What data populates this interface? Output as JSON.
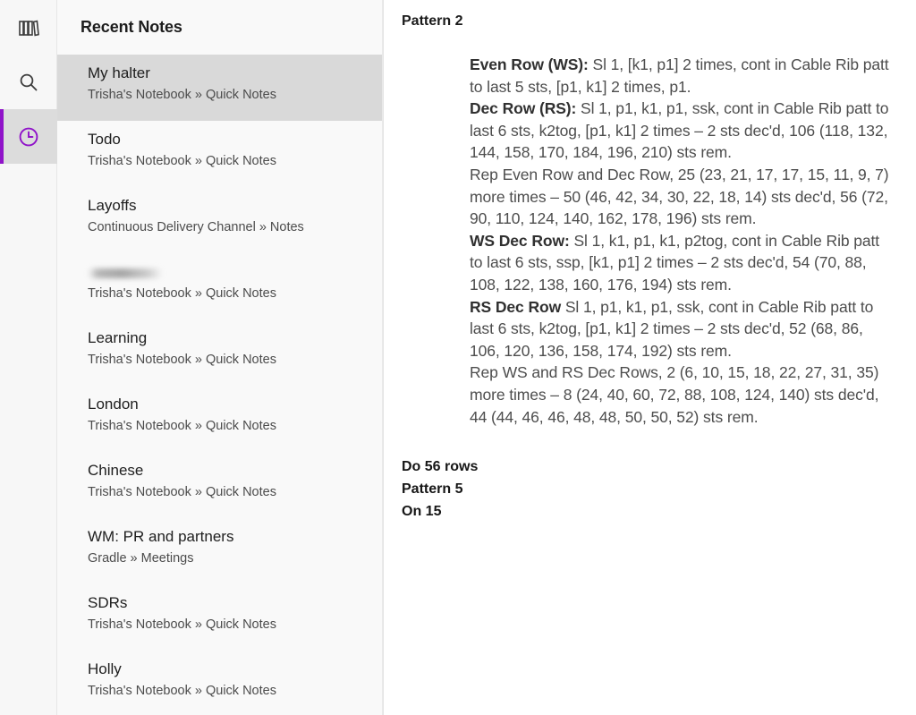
{
  "rail": {
    "items": [
      {
        "icon": "books-icon",
        "label": "Notebooks",
        "selected": false
      },
      {
        "icon": "search-icon",
        "label": "Search",
        "selected": false
      },
      {
        "icon": "clock-icon",
        "label": "Recent",
        "selected": true
      }
    ],
    "accent_color": "#9013c9",
    "selected_bg": "#dcdcdc"
  },
  "list": {
    "header_title": "Recent Notes",
    "items": [
      {
        "title": "My halter",
        "path": "Trisha's Notebook » Quick Notes",
        "selected": true,
        "redacted": false
      },
      {
        "title": "Todo",
        "path": "Trisha's Notebook » Quick Notes",
        "selected": false,
        "redacted": false
      },
      {
        "title": "Layoffs",
        "path": "Continuous Delivery Channel » Notes",
        "selected": false,
        "redacted": false
      },
      {
        "title": "",
        "path": "Trisha's Notebook » Quick Notes",
        "selected": false,
        "redacted": true
      },
      {
        "title": "Learning",
        "path": "Trisha's Notebook » Quick Notes",
        "selected": false,
        "redacted": false
      },
      {
        "title": "London",
        "path": "Trisha's Notebook » Quick Notes",
        "selected": false,
        "redacted": false
      },
      {
        "title": "Chinese",
        "path": "Trisha's Notebook » Quick Notes",
        "selected": false,
        "redacted": false
      },
      {
        "title": "WM: PR and partners",
        "path": "Gradle » Meetings",
        "selected": false,
        "redacted": false
      },
      {
        "title": "SDRs",
        "path": "Trisha's Notebook » Quick Notes",
        "selected": false,
        "redacted": false
      },
      {
        "title": "Holly",
        "path": "Trisha's Notebook » Quick Notes",
        "selected": false,
        "redacted": false
      }
    ]
  },
  "note": {
    "title": "Pattern 2",
    "paragraphs": [
      {
        "label": "Even Row (WS):",
        "text": " Sl 1, [k1, p1] 2 times, cont in Cable Rib patt to last 5 sts, [p1, k1] 2 times, p1."
      },
      {
        "label": "Dec Row (RS):",
        "text": " Sl 1, p1, k1, p1, ssk, cont in Cable Rib patt to last 6 sts, k2tog, [p1, k1] 2 times – 2 sts dec'd, 106 (118, 132, 144, 158, 170, 184, 196, 210) sts rem."
      },
      {
        "label": "",
        "text": "Rep Even Row and Dec Row, 25 (23, 21, 17, 17, 15, 11, 9, 7) more times – 50 (46, 42, 34, 30, 22, 18, 14) sts dec'd, 56 (72, 90, 110, 124, 140, 162, 178, 196) sts rem."
      },
      {
        "label": "WS Dec Row:",
        "text": " Sl 1, k1, p1, k1, p2tog, cont in Cable Rib patt to last 6 sts, ssp, [k1, p1] 2 times – 2 sts dec'd, 54 (70, 88, 108, 122, 138, 160, 176, 194) sts rem."
      },
      {
        "label": "RS Dec Row",
        "text": " Sl 1, p1, k1, p1, ssk, cont in Cable Rib patt to last 6 sts, k2tog, [p1, k1] 2 times – 2 sts dec'd, 52 (68, 86, 106, 120, 136, 158, 174, 192) sts rem."
      },
      {
        "label": "",
        "text": "Rep WS and RS Dec Rows, 2 (6, 10, 15, 18, 22, 27, 31, 35) more times – 8 (24, 40, 60, 72, 88, 108, 124, 140) sts dec'd, 44 (44, 46, 46, 48, 48, 50, 50, 52) sts rem."
      }
    ],
    "tail_lines": [
      "Do 56 rows",
      "Pattern 5",
      "On 15"
    ]
  }
}
